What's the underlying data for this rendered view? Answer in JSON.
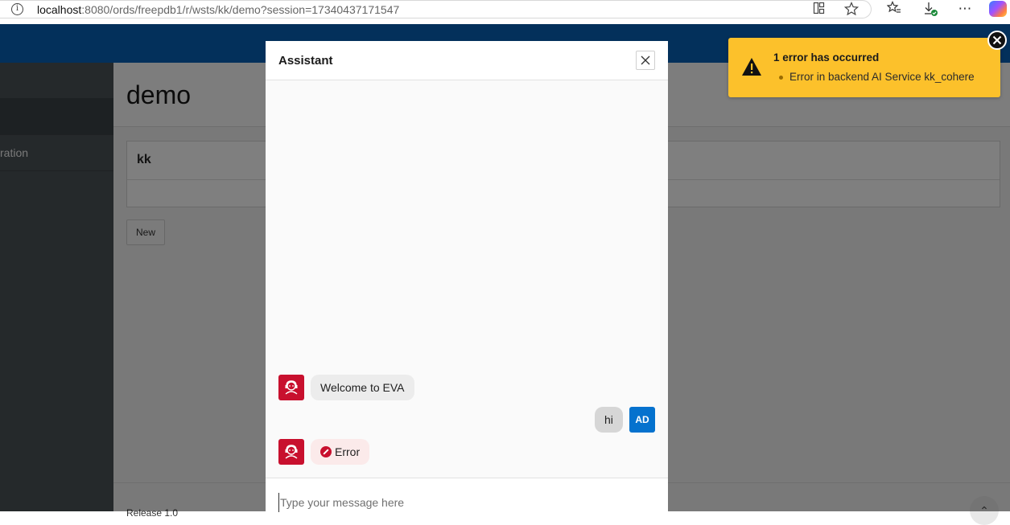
{
  "browser": {
    "url_host": "localhost",
    "url_rest": ":8080/ords/freepdb1/r/wsts/kk/demo?session=17340437171547"
  },
  "app": {
    "sidebar": {
      "items": [
        "",
        "",
        "ration"
      ]
    },
    "page_title": "demo",
    "region_title": "kk",
    "new_button": "New",
    "footer": "Release 1.0"
  },
  "dialog": {
    "title": "Assistant",
    "messages": [
      {
        "sender": "bot",
        "text": "Welcome to EVA"
      },
      {
        "sender": "user",
        "text": "hi",
        "initials": "AD"
      },
      {
        "sender": "bot",
        "text": "Error",
        "is_error": true
      }
    ],
    "input_placeholder": "Type your message here"
  },
  "notification": {
    "title": "1 error has occurred",
    "items": [
      "Error in backend AI Service kk_cohere"
    ]
  },
  "colors": {
    "header_blue": "#0660b6",
    "bot_avatar_red": "#c8102e",
    "user_avatar_blue": "#0572ce",
    "notification_yellow": "#fcc12b"
  }
}
